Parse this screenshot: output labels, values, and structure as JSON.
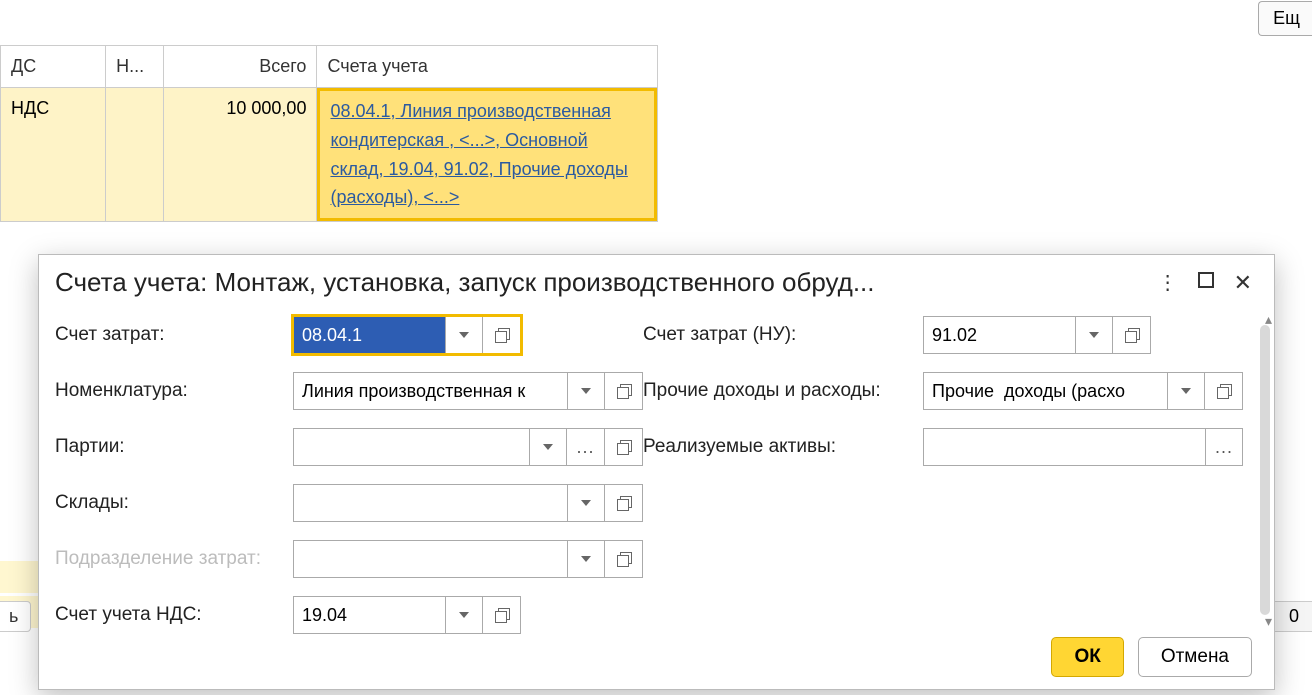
{
  "top_button": "Ещ",
  "table": {
    "headers": {
      "col1": "ДС",
      "col2": "Н...",
      "col3": "Всего",
      "col4": "Счета учета"
    },
    "row": {
      "col1": "НДС",
      "col2": "",
      "col3": "10 000,00",
      "col4_link": "08.04.1, Линия производственная кондитерская , <...>, Основной склад, 19.04, 91.02, Прочие доходы (расходы), <...>"
    }
  },
  "dialog": {
    "title": "Счета учета: Монтаж, установка, запуск производственного обруд...",
    "labels": {
      "schet_zatrat": "Счет затрат:",
      "schet_zatrat_nu": "Счет затрат (НУ):",
      "nomenklatura": "Номенклатура:",
      "prochie": "Прочие доходы и расходы:",
      "partii": "Партии:",
      "realiz": "Реализуемые активы:",
      "sklady": "Склады:",
      "podrazd": "Подразделение затрат:",
      "schet_nds": "Счет учета НДС:"
    },
    "values": {
      "schet_zatrat": "08.04.1",
      "schet_zatrat_nu": "91.02",
      "nomenklatura": "Линия производственная к",
      "prochie": "Прочие  доходы (расхо",
      "partii": "",
      "realiz": "",
      "sklady": "",
      "podrazd": "",
      "schet_nds": "19.04"
    },
    "buttons": {
      "ok": "ОК",
      "cancel": "Отмена"
    }
  },
  "bg": {
    "letter": "ь",
    "zero": "0"
  }
}
